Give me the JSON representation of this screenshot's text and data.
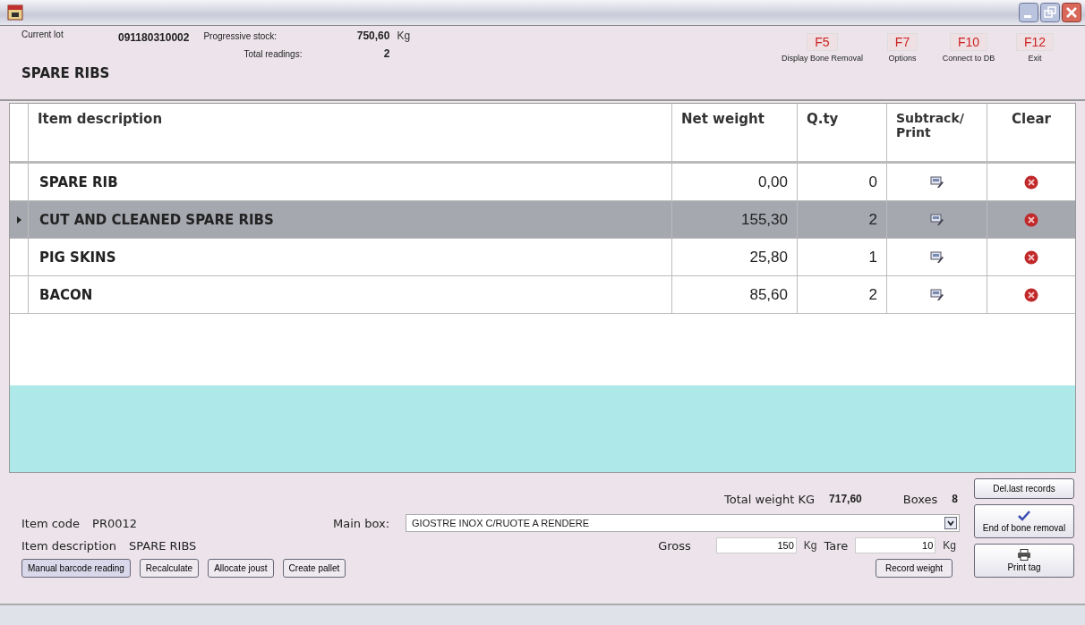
{
  "header": {
    "current_lot": {
      "label": "Current lot",
      "value": "091180310002"
    },
    "product": "SPARE RIBS",
    "progressive_stock": {
      "label": "Progressive stock:",
      "value": "750,60",
      "unit": "Kg"
    },
    "total_readings": {
      "label": "Total readings:",
      "value": "2"
    },
    "function_keys": [
      {
        "key": "F5",
        "label": "Display Bone Removal"
      },
      {
        "key": "F7",
        "label": "Options"
      },
      {
        "key": "F10",
        "label": "Connect to DB"
      },
      {
        "key": "F12",
        "label": "Exit"
      }
    ]
  },
  "table": {
    "columns": [
      "Item description",
      "Net weight",
      "Q.ty",
      "Subtrack/ Print",
      "Clear"
    ],
    "rows": [
      {
        "description": "SPARE RIB",
        "net_weight": "0,00",
        "qty": "0",
        "selected": false
      },
      {
        "description": "CUT AND CLEANED SPARE RIBS",
        "net_weight": "155,30",
        "qty": "2",
        "selected": true
      },
      {
        "description": "PIG SKINS",
        "net_weight": "25,80",
        "qty": "1",
        "selected": false
      },
      {
        "description": "BACON",
        "net_weight": "85,60",
        "qty": "2",
        "selected": false
      }
    ]
  },
  "footer": {
    "total_weight": {
      "label": "Total weight KG",
      "value": "717,60"
    },
    "boxes": {
      "label": "Boxes",
      "value": "8"
    },
    "item_code": {
      "label": "Item code",
      "value": "PR0012"
    },
    "item_description": {
      "label": "Item description",
      "value": "SPARE RIBS"
    },
    "main_box": {
      "label": "Main box:",
      "value": "GIOSTRE INOX C/RUOTE A RENDERE"
    },
    "gross": {
      "label": "Gross",
      "value": "150",
      "unit": "Kg"
    },
    "tare": {
      "label": "Tare",
      "value": "10",
      "unit": "Kg"
    },
    "buttons": [
      "Manual barcode reading",
      "Recalculate",
      "Allocate joust",
      "Create pallet"
    ],
    "record_weight": "Record weight",
    "side_buttons": [
      {
        "label": "Del.last records",
        "kind": "plain"
      },
      {
        "label": "End of bone removal",
        "kind": "check"
      },
      {
        "label": "Print tag",
        "kind": "print"
      }
    ]
  }
}
